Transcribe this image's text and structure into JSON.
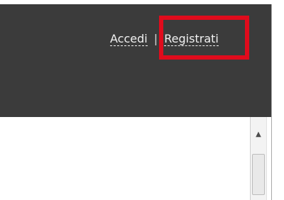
{
  "header": {
    "login_label": "Accedi",
    "separator": "|",
    "register_label": "Registrati"
  },
  "scrollbar": {
    "up_arrow": "▲"
  },
  "colors": {
    "header_background": "#3b3b3b",
    "link_text": "#f2f2f2",
    "highlight": "#e00b1c",
    "content_background": "#ffffff"
  },
  "icons": {
    "scroll_up": "scroll-up-arrow-icon"
  }
}
